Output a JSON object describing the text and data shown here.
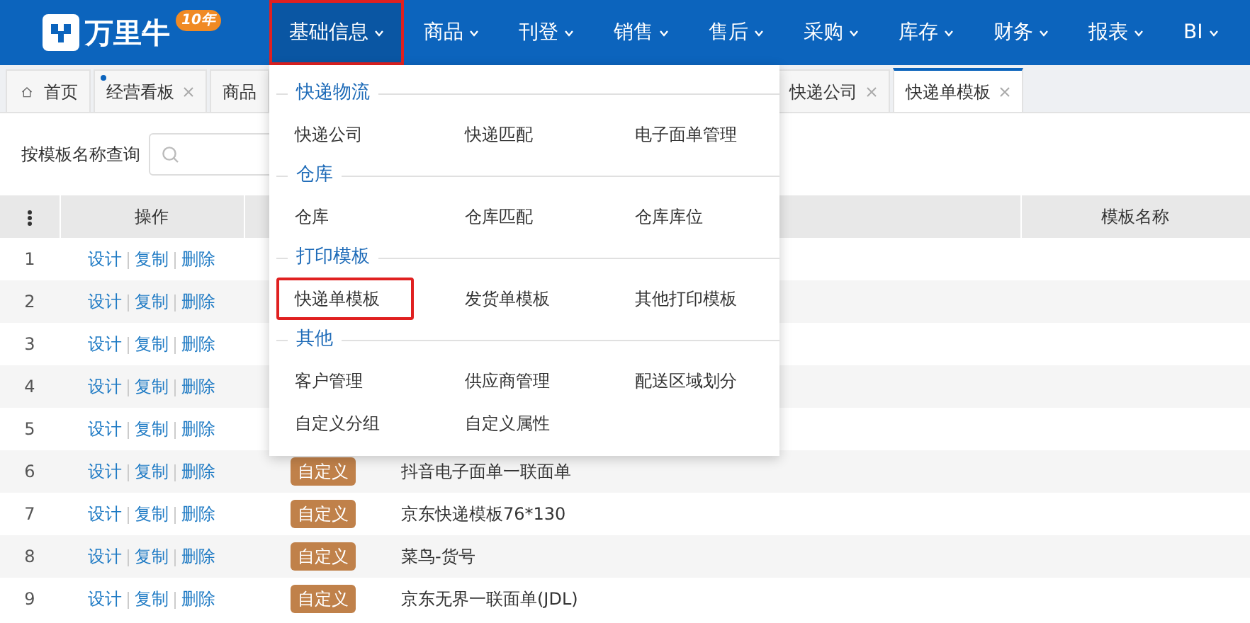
{
  "navbar": {
    "logo": "万里牛",
    "anniversary": "10年",
    "menus": [
      {
        "label": "基础信息",
        "selected": true,
        "highlighted": true
      },
      {
        "label": "商品",
        "selected": false,
        "highlighted": false
      },
      {
        "label": "刊登",
        "selected": false,
        "highlighted": false
      },
      {
        "label": "销售",
        "selected": false,
        "highlighted": false
      },
      {
        "label": "售后",
        "selected": false,
        "highlighted": false
      },
      {
        "label": "采购",
        "selected": false,
        "highlighted": false
      },
      {
        "label": "库存",
        "selected": false,
        "highlighted": false
      },
      {
        "label": "财务",
        "selected": false,
        "highlighted": false
      },
      {
        "label": "报表",
        "selected": false,
        "highlighted": false
      },
      {
        "label": "BI",
        "selected": false,
        "highlighted": false
      }
    ]
  },
  "tabs": [
    {
      "label": "首页",
      "kind": "home",
      "selected": false,
      "closable": false,
      "dot": false
    },
    {
      "label": "经营看板",
      "kind": "page",
      "selected": false,
      "closable": true,
      "dot": true
    },
    {
      "label": "商品",
      "kind": "page",
      "selected": false,
      "closable": false,
      "dot": false
    },
    {
      "label": "快递公司",
      "kind": "page",
      "selected": false,
      "closable": true,
      "dot": false
    },
    {
      "label": "快递单模板",
      "kind": "page",
      "selected": true,
      "closable": true,
      "dot": false
    }
  ],
  "search": {
    "label": "按模板名称查询"
  },
  "table": {
    "columns": [
      "操作",
      "模板名称"
    ],
    "rows": [
      {
        "index": "1",
        "actions": [
          "设计",
          "复制",
          "删除"
        ]
      },
      {
        "index": "2",
        "actions": [
          "设计",
          "复制",
          "删除"
        ]
      },
      {
        "index": "3",
        "actions": [
          "设计",
          "复制",
          "删除"
        ]
      },
      {
        "index": "4",
        "actions": [
          "设计",
          "复制",
          "删除"
        ]
      },
      {
        "index": "5",
        "actions": [
          "设计",
          "复制",
          "删除"
        ]
      },
      {
        "index": "6",
        "actions": [
          "设计",
          "复制",
          "删除"
        ],
        "tag": "自定义",
        "name": "抖音电子面单一联面单"
      },
      {
        "index": "7",
        "actions": [
          "设计",
          "复制",
          "删除"
        ],
        "tag": "自定义",
        "name": "京东快递模板76*130"
      },
      {
        "index": "8",
        "actions": [
          "设计",
          "复制",
          "删除"
        ],
        "tag": "自定义",
        "name": "菜鸟-货号"
      },
      {
        "index": "9",
        "actions": [
          "设计",
          "复制",
          "删除"
        ],
        "tag": "自定义",
        "name": "京东无界一联面单(JDL)"
      }
    ]
  },
  "dropdown": {
    "sections": [
      {
        "title": "快递物流",
        "items": [
          {
            "label": "快递公司",
            "highlighted": false
          },
          {
            "label": "快递匹配",
            "highlighted": false
          },
          {
            "label": "电子面单管理",
            "highlighted": false
          }
        ]
      },
      {
        "title": "仓库",
        "items": [
          {
            "label": "仓库",
            "highlighted": false
          },
          {
            "label": "仓库匹配",
            "highlighted": false
          },
          {
            "label": "仓库库位",
            "highlighted": false
          }
        ]
      },
      {
        "title": "打印模板",
        "items": [
          {
            "label": "快递单模板",
            "highlighted": true
          },
          {
            "label": "发货单模板",
            "highlighted": false
          },
          {
            "label": "其他打印模板",
            "highlighted": false
          }
        ]
      },
      {
        "title": "其他",
        "items": [
          {
            "label": "客户管理",
            "highlighted": false
          },
          {
            "label": "供应商管理",
            "highlighted": false
          },
          {
            "label": "配送区域划分",
            "highlighted": false
          },
          {
            "label": "自定义分组",
            "highlighted": false
          },
          {
            "label": "自定义属性",
            "highlighted": false
          }
        ]
      }
    ]
  }
}
